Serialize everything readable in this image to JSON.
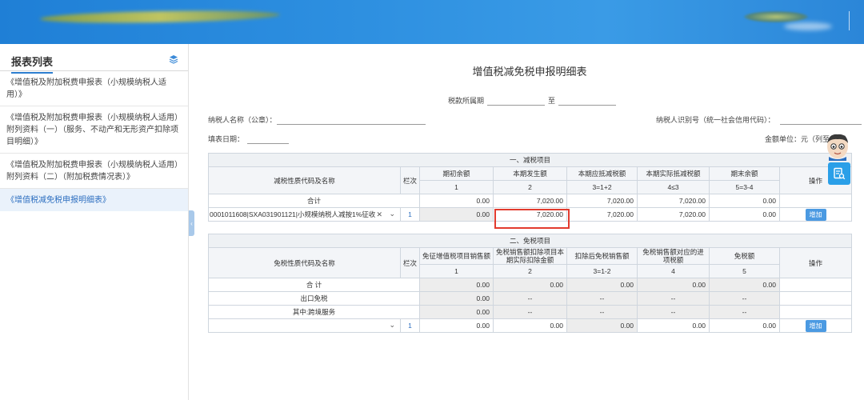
{
  "sidebar": {
    "title": "报表列表",
    "items": [
      {
        "label": "《增值税及附加税费申报表（小规模纳税人适用）》",
        "active": false
      },
      {
        "label": "《增值税及附加税费申报表（小规模纳税人适用）附列资料（一）（服务、不动产和无形资产扣除项目明细）》",
        "active": false
      },
      {
        "label": "《增值税及附加税费申报表（小规模纳税人适用）附列资料（二）（附加税费情况表）》",
        "active": false
      },
      {
        "label": "《增值税减免税申报明细表》",
        "active": true
      }
    ]
  },
  "form": {
    "title": "增值税减免税申报明细表",
    "period_label": "税款所属期",
    "period_to": "至",
    "taxpayer_name_label": "纳税人名称（公章）：",
    "taxpayer_id_label": "纳税人识别号（统一社会信用代码）：",
    "fill_date_label": "填表日期：",
    "unit_label": "金额单位：元（列至角分）"
  },
  "reduction": {
    "section_title": "一、减税项目",
    "headers": {
      "code_name": "减税性质代码及名称",
      "row_no": "栏次",
      "opening": "期初余额",
      "current_amount": "本期发生额",
      "current_deductible": "本期应抵减税额",
      "current_actual": "本期实际抵减税额",
      "closing": "期末余额",
      "operation": "操作"
    },
    "col_numbers": [
      "1",
      "2",
      "3=1+2",
      "4≤3",
      "5=3-4"
    ],
    "total": {
      "label": "合计",
      "values": [
        "0.00",
        "7,020.00",
        "7,020.00",
        "7,020.00",
        "0.00"
      ]
    },
    "row": {
      "code": "0001011608|SXA031901121|小规模纳税人减按1%征收",
      "row_no": "1",
      "values": [
        "0.00",
        "7,020.00",
        "7,020.00",
        "7,020.00",
        "0.00"
      ],
      "add_button": "增加"
    }
  },
  "exemption": {
    "section_title": "二、免税项目",
    "headers": {
      "code_name": "免税性质代码及名称",
      "row_no": "栏次",
      "exempt_sales": "免征增值税项目销售额",
      "deduction": "免税销售额扣除项目本期实际扣除金额",
      "after_deduction": "扣除后免税销售额",
      "input_tax": "免税销售额对应的进项税额",
      "exempt_tax": "免税额",
      "operation": "操作"
    },
    "col_numbers": [
      "1",
      "2",
      "3=1-2",
      "4",
      "5"
    ],
    "rows": [
      {
        "label": "合  计",
        "values": [
          "0.00",
          "0.00",
          "0.00",
          "0.00",
          "0.00"
        ]
      },
      {
        "label": "出口免税",
        "values": [
          "0.00",
          "--",
          "--",
          "--",
          "--"
        ]
      },
      {
        "label": "其中:跨境服务",
        "values": [
          "0.00",
          "--",
          "--",
          "--",
          "--"
        ]
      }
    ],
    "input_row": {
      "row_no": "1",
      "values": [
        "0.00",
        "0.00",
        "0.00",
        "0.00",
        "0.00"
      ],
      "add_button": "增加"
    }
  },
  "colors": {
    "banner": "#2d8fe0",
    "accent": "#2d7fd0",
    "highlight": "#e23b2e",
    "button": "#4b9ae2"
  }
}
